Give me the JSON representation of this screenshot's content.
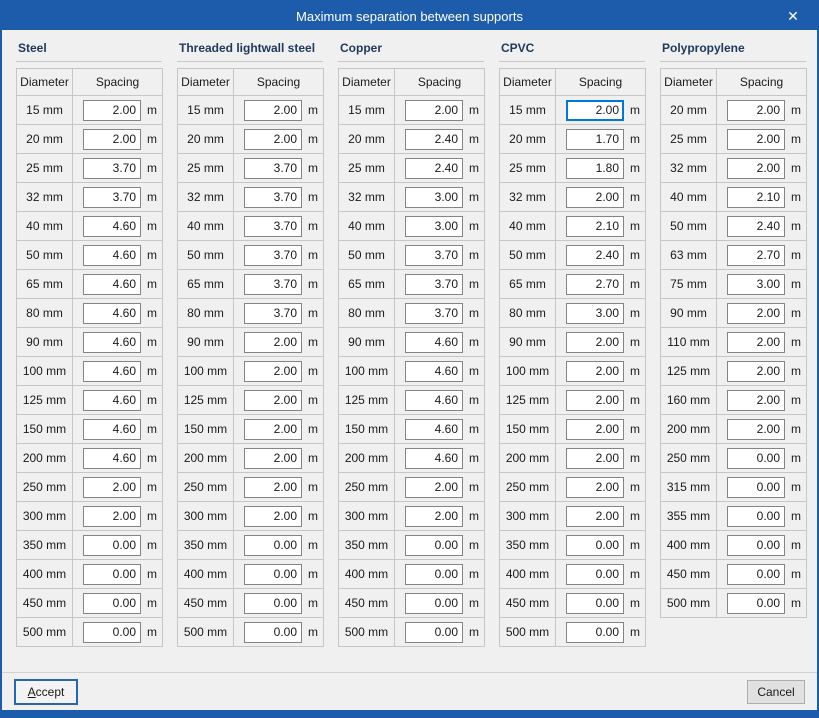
{
  "window": {
    "title": "Maximum separation between supports",
    "close_glyph": "✕"
  },
  "columns": {
    "diameter": "Diameter",
    "spacing": "Spacing"
  },
  "unit": "m",
  "materials": [
    {
      "name": "Steel",
      "rows": [
        {
          "d": "15 mm",
          "s": "2.00"
        },
        {
          "d": "20 mm",
          "s": "2.00"
        },
        {
          "d": "25 mm",
          "s": "3.70"
        },
        {
          "d": "32 mm",
          "s": "3.70"
        },
        {
          "d": "40 mm",
          "s": "4.60"
        },
        {
          "d": "50 mm",
          "s": "4.60"
        },
        {
          "d": "65 mm",
          "s": "4.60"
        },
        {
          "d": "80 mm",
          "s": "4.60"
        },
        {
          "d": "90 mm",
          "s": "4.60"
        },
        {
          "d": "100 mm",
          "s": "4.60"
        },
        {
          "d": "125 mm",
          "s": "4.60"
        },
        {
          "d": "150 mm",
          "s": "4.60"
        },
        {
          "d": "200 mm",
          "s": "4.60"
        },
        {
          "d": "250 mm",
          "s": "2.00"
        },
        {
          "d": "300 mm",
          "s": "2.00"
        },
        {
          "d": "350 mm",
          "s": "0.00"
        },
        {
          "d": "400 mm",
          "s": "0.00"
        },
        {
          "d": "450 mm",
          "s": "0.00"
        },
        {
          "d": "500 mm",
          "s": "0.00"
        }
      ]
    },
    {
      "name": "Threaded lightwall steel",
      "rows": [
        {
          "d": "15 mm",
          "s": "2.00"
        },
        {
          "d": "20 mm",
          "s": "2.00"
        },
        {
          "d": "25 mm",
          "s": "3.70"
        },
        {
          "d": "32 mm",
          "s": "3.70"
        },
        {
          "d": "40 mm",
          "s": "3.70"
        },
        {
          "d": "50 mm",
          "s": "3.70"
        },
        {
          "d": "65 mm",
          "s": "3.70"
        },
        {
          "d": "80 mm",
          "s": "3.70"
        },
        {
          "d": "90 mm",
          "s": "2.00"
        },
        {
          "d": "100 mm",
          "s": "2.00"
        },
        {
          "d": "125 mm",
          "s": "2.00"
        },
        {
          "d": "150 mm",
          "s": "2.00"
        },
        {
          "d": "200 mm",
          "s": "2.00"
        },
        {
          "d": "250 mm",
          "s": "2.00"
        },
        {
          "d": "300 mm",
          "s": "2.00"
        },
        {
          "d": "350 mm",
          "s": "0.00"
        },
        {
          "d": "400 mm",
          "s": "0.00"
        },
        {
          "d": "450 mm",
          "s": "0.00"
        },
        {
          "d": "500 mm",
          "s": "0.00"
        }
      ]
    },
    {
      "name": "Copper",
      "rows": [
        {
          "d": "15 mm",
          "s": "2.00"
        },
        {
          "d": "20 mm",
          "s": "2.40"
        },
        {
          "d": "25 mm",
          "s": "2.40"
        },
        {
          "d": "32 mm",
          "s": "3.00"
        },
        {
          "d": "40 mm",
          "s": "3.00"
        },
        {
          "d": "50 mm",
          "s": "3.70"
        },
        {
          "d": "65 mm",
          "s": "3.70"
        },
        {
          "d": "80 mm",
          "s": "3.70"
        },
        {
          "d": "90 mm",
          "s": "4.60"
        },
        {
          "d": "100 mm",
          "s": "4.60"
        },
        {
          "d": "125 mm",
          "s": "4.60"
        },
        {
          "d": "150 mm",
          "s": "4.60"
        },
        {
          "d": "200 mm",
          "s": "4.60"
        },
        {
          "d": "250 mm",
          "s": "2.00"
        },
        {
          "d": "300 mm",
          "s": "2.00"
        },
        {
          "d": "350 mm",
          "s": "0.00"
        },
        {
          "d": "400 mm",
          "s": "0.00"
        },
        {
          "d": "450 mm",
          "s": "0.00"
        },
        {
          "d": "500 mm",
          "s": "0.00"
        }
      ]
    },
    {
      "name": "CPVC",
      "focused_row": 0,
      "rows": [
        {
          "d": "15 mm",
          "s": "2.00"
        },
        {
          "d": "20 mm",
          "s": "1.70"
        },
        {
          "d": "25 mm",
          "s": "1.80"
        },
        {
          "d": "32 mm",
          "s": "2.00"
        },
        {
          "d": "40 mm",
          "s": "2.10"
        },
        {
          "d": "50 mm",
          "s": "2.40"
        },
        {
          "d": "65 mm",
          "s": "2.70"
        },
        {
          "d": "80 mm",
          "s": "3.00"
        },
        {
          "d": "90 mm",
          "s": "2.00"
        },
        {
          "d": "100 mm",
          "s": "2.00"
        },
        {
          "d": "125 mm",
          "s": "2.00"
        },
        {
          "d": "150 mm",
          "s": "2.00"
        },
        {
          "d": "200 mm",
          "s": "2.00"
        },
        {
          "d": "250 mm",
          "s": "2.00"
        },
        {
          "d": "300 mm",
          "s": "2.00"
        },
        {
          "d": "350 mm",
          "s": "0.00"
        },
        {
          "d": "400 mm",
          "s": "0.00"
        },
        {
          "d": "450 mm",
          "s": "0.00"
        },
        {
          "d": "500 mm",
          "s": "0.00"
        }
      ]
    },
    {
      "name": "Polypropylene",
      "rows": [
        {
          "d": "20 mm",
          "s": "2.00"
        },
        {
          "d": "25 mm",
          "s": "2.00"
        },
        {
          "d": "32 mm",
          "s": "2.00"
        },
        {
          "d": "40 mm",
          "s": "2.10"
        },
        {
          "d": "50 mm",
          "s": "2.40"
        },
        {
          "d": "63 mm",
          "s": "2.70"
        },
        {
          "d": "75 mm",
          "s": "3.00"
        },
        {
          "d": "90 mm",
          "s": "2.00"
        },
        {
          "d": "110 mm",
          "s": "2.00"
        },
        {
          "d": "125 mm",
          "s": "2.00"
        },
        {
          "d": "160 mm",
          "s": "2.00"
        },
        {
          "d": "200 mm",
          "s": "2.00"
        },
        {
          "d": "250 mm",
          "s": "0.00"
        },
        {
          "d": "315 mm",
          "s": "0.00"
        },
        {
          "d": "355 mm",
          "s": "0.00"
        },
        {
          "d": "400 mm",
          "s": "0.00"
        },
        {
          "d": "450 mm",
          "s": "0.00"
        },
        {
          "d": "500 mm",
          "s": "0.00"
        }
      ]
    }
  ],
  "footer": {
    "accept_label": "Accept",
    "cancel_label": "Cancel"
  },
  "colors": {
    "titlebar_blue": "#1d5cab",
    "accent_blue": "#0078d7",
    "accept_border": "#2866ae",
    "dialog_bg": "#f0f0f0",
    "label_navy": "#203a5c",
    "grid_gray": "#c6c6c6",
    "input_border": "#848484"
  }
}
